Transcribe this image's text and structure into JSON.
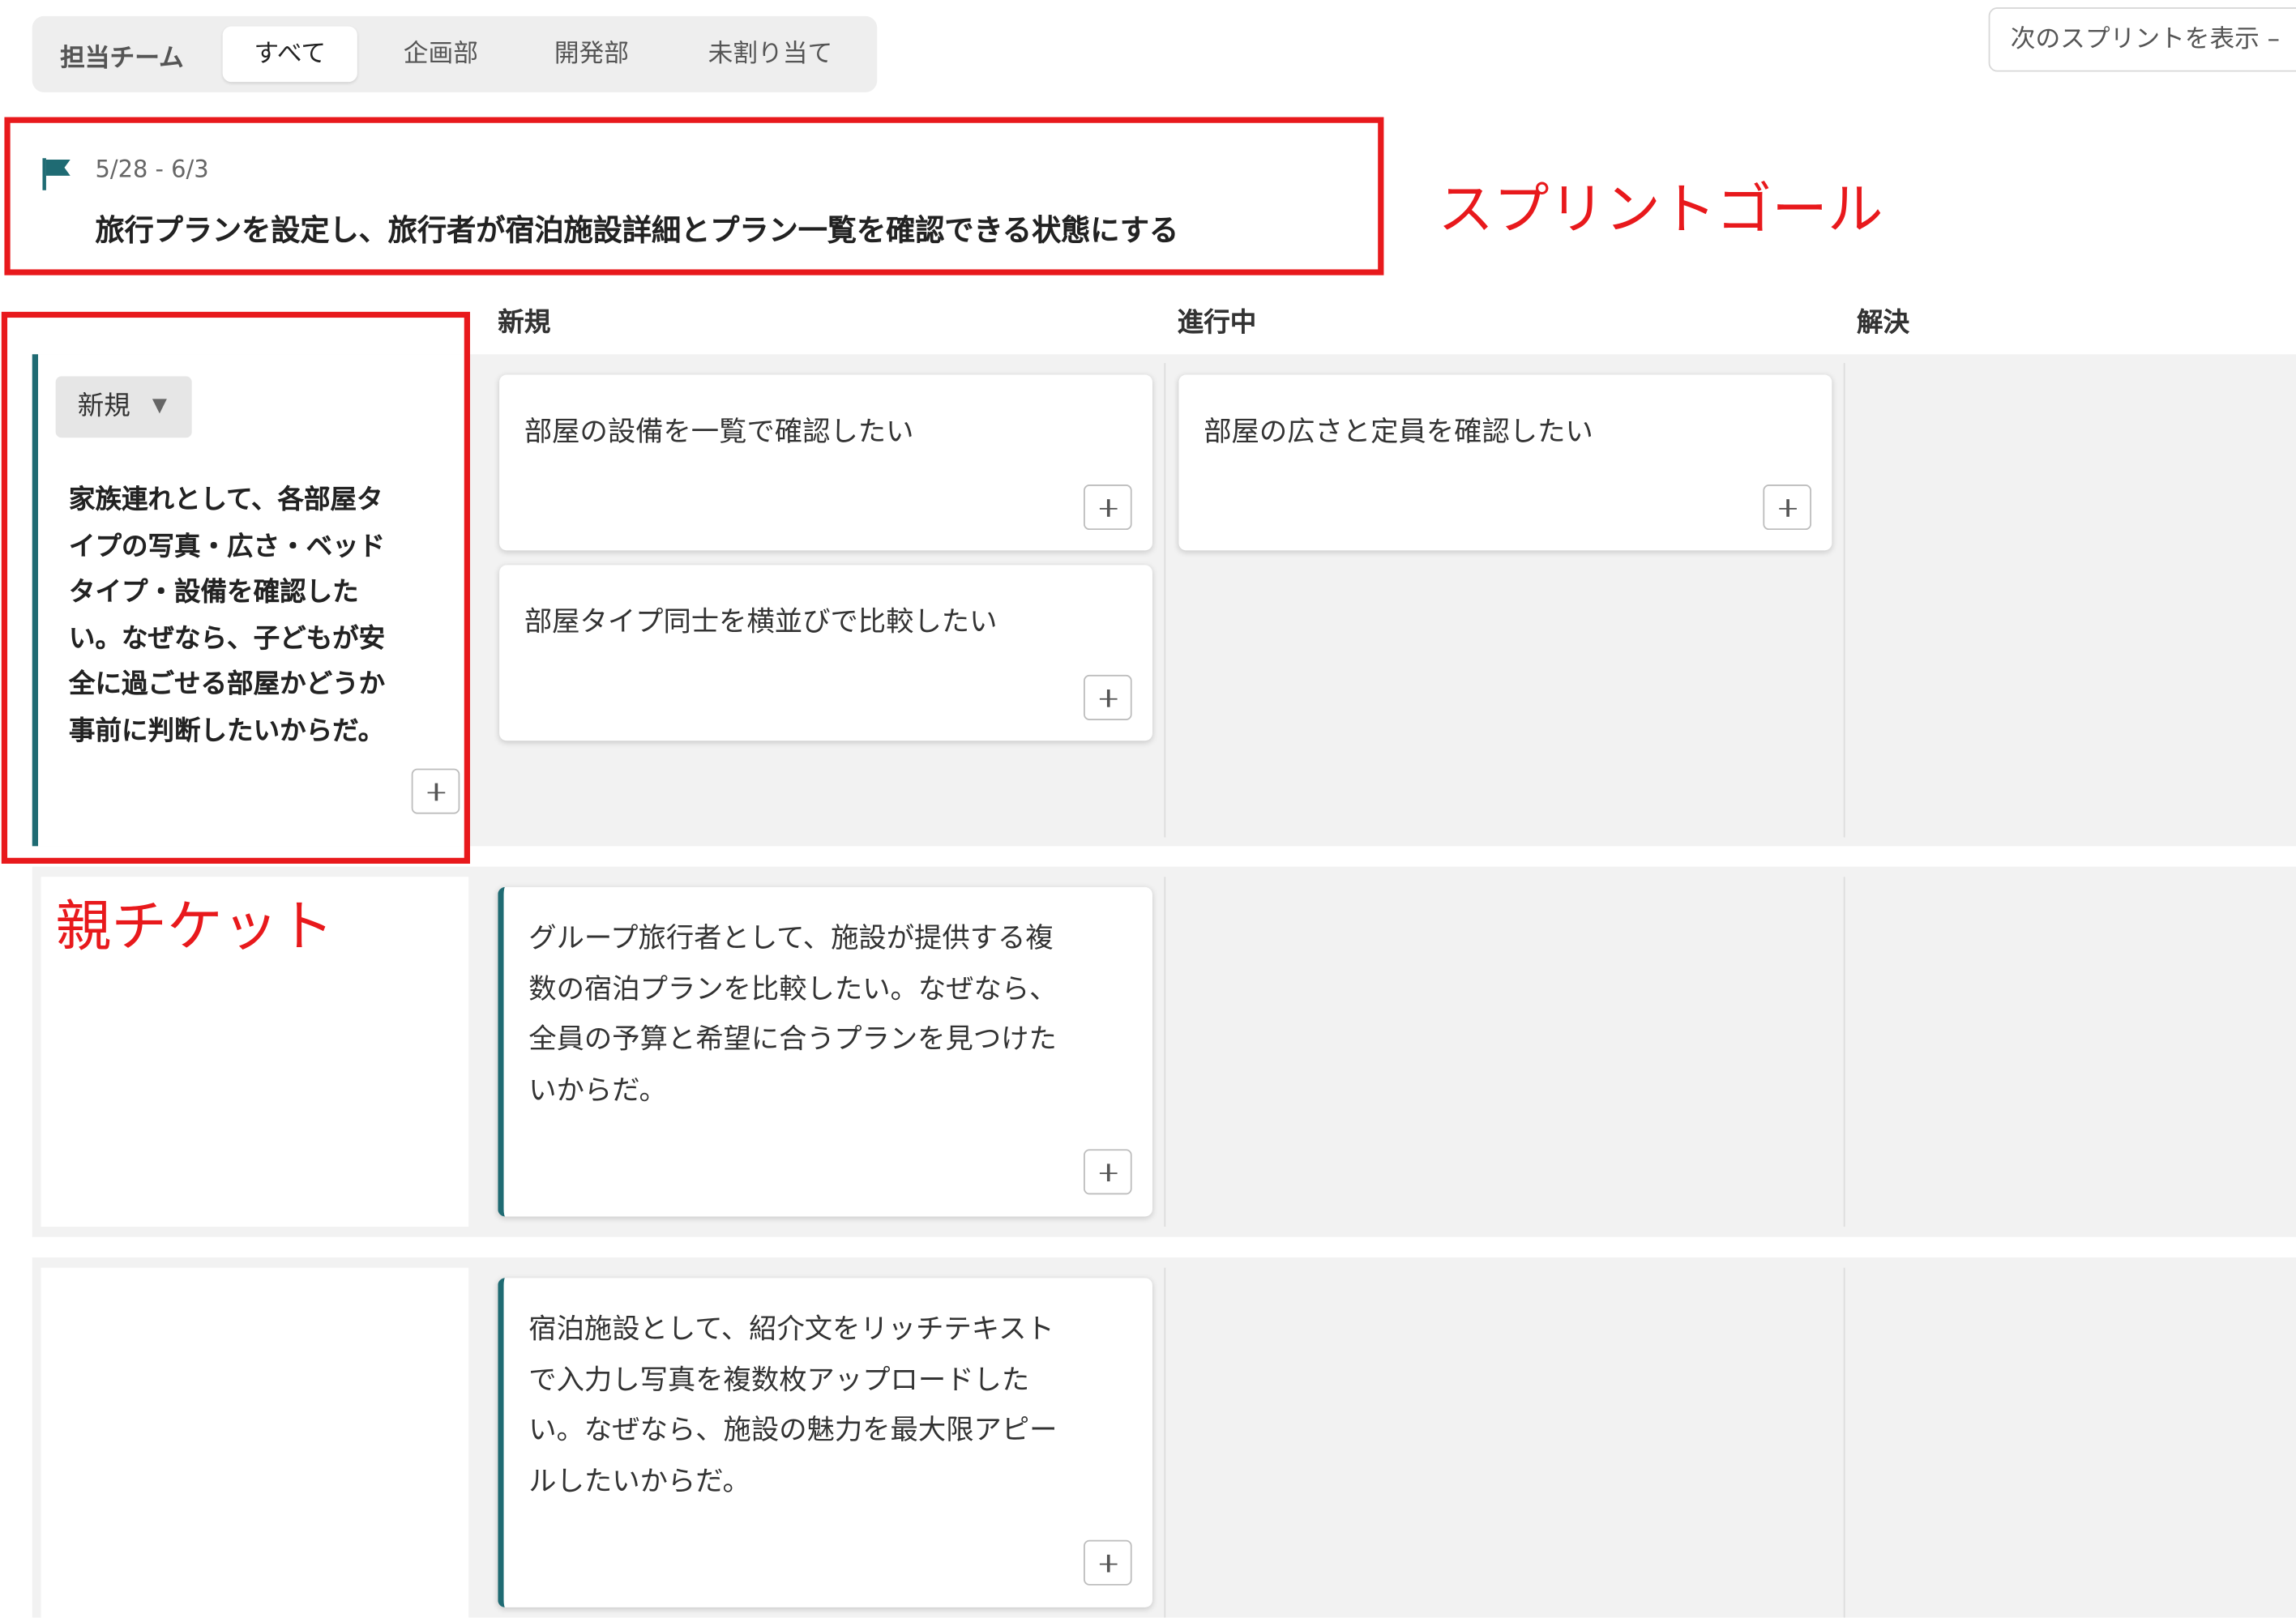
{
  "filter": {
    "label": "担当チーム",
    "tabs": [
      {
        "label": "すべて",
        "active": true
      },
      {
        "label": "企画部",
        "active": false
      },
      {
        "label": "開発部",
        "active": false
      },
      {
        "label": "未割り当て",
        "active": false
      }
    ]
  },
  "next_sprint_label": "次のスプリントを表示 –",
  "sprint": {
    "dates": "5/28 - 6/3",
    "goal": "旅行プランを設定し、旅行者が宿泊施設詳細とプラン一覧を確認できる状態にする",
    "icon": "flag-icon"
  },
  "annotations": {
    "sprint_goal": "スプリントゴール",
    "parent_ticket": "親チケット"
  },
  "columns": [
    "新規",
    "進行中",
    "解決"
  ],
  "parent_ticket": {
    "status": "新規",
    "lines": [
      "家族連れとして、各部屋タ",
      "イプの写真・広さ・ベッド",
      "タイプ・設備を確認した",
      "い。なぜなら、子どもが安",
      "全に過ごせる部屋かどうか",
      "事前に判断したいからだ。"
    ]
  },
  "cards": {
    "room_equipment": "部屋の設備を一覧で確認したい",
    "room_compare": "部屋タイプ同士を横並びで比較したい",
    "room_size": "部屋の広さと定員を確認したい",
    "group_story": [
      "グループ旅行者として、施設が提供する複",
      "数の宿泊プランを比較したい。なぜなら、",
      "全員の予算と希望に合うプランを見つけた",
      "いからだ。"
    ],
    "facility_story": [
      "宿泊施設として、紹介文をリッチテキスト",
      "で入力し写真を複数枚アップロードした",
      "い。なぜなら、施設の魅力を最大限アピー",
      "ルしたいからだ。"
    ]
  },
  "colors": {
    "accent": "#1f6b73",
    "highlight": "#e8191c",
    "lane_bg": "#f2f2f2"
  }
}
